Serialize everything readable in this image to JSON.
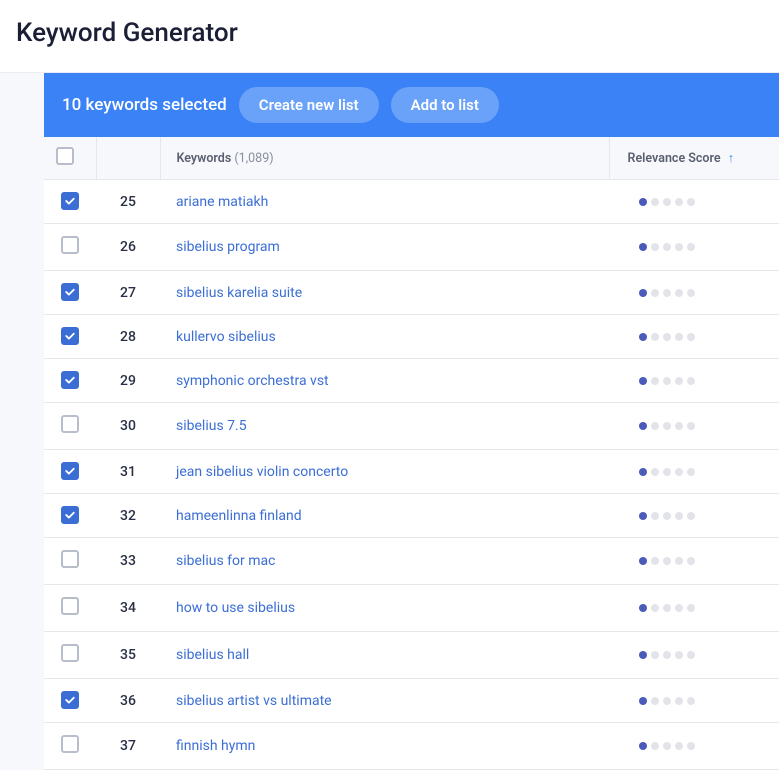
{
  "page": {
    "title": "Keyword Generator"
  },
  "toolbar": {
    "selected_text": "10 keywords selected",
    "create_label": "Create new list",
    "add_label": "Add to list"
  },
  "columns": {
    "keywords_label": "Keywords",
    "keywords_count": "(1,089)",
    "score_label": "Relevance Score"
  },
  "rows": [
    {
      "num": "25",
      "keyword": "ariane matiakh",
      "checked": true,
      "score": 1
    },
    {
      "num": "26",
      "keyword": "sibelius program",
      "checked": false,
      "score": 1
    },
    {
      "num": "27",
      "keyword": "sibelius karelia suite",
      "checked": true,
      "score": 1
    },
    {
      "num": "28",
      "keyword": "kullervo sibelius",
      "checked": true,
      "score": 1
    },
    {
      "num": "29",
      "keyword": "symphonic orchestra vst",
      "checked": true,
      "score": 1
    },
    {
      "num": "30",
      "keyword": "sibelius 7.5",
      "checked": false,
      "score": 1
    },
    {
      "num": "31",
      "keyword": "jean sibelius violin concerto",
      "checked": true,
      "score": 1
    },
    {
      "num": "32",
      "keyword": "hameenlinna finland",
      "checked": true,
      "score": 1
    },
    {
      "num": "33",
      "keyword": "sibelius for mac",
      "checked": false,
      "score": 1
    },
    {
      "num": "34",
      "keyword": "how to use sibelius",
      "checked": false,
      "score": 1
    },
    {
      "num": "35",
      "keyword": "sibelius hall",
      "checked": false,
      "score": 1
    },
    {
      "num": "36",
      "keyword": "sibelius artist vs ultimate",
      "checked": true,
      "score": 1
    },
    {
      "num": "37",
      "keyword": "finnish hymn",
      "checked": false,
      "score": 1
    }
  ]
}
